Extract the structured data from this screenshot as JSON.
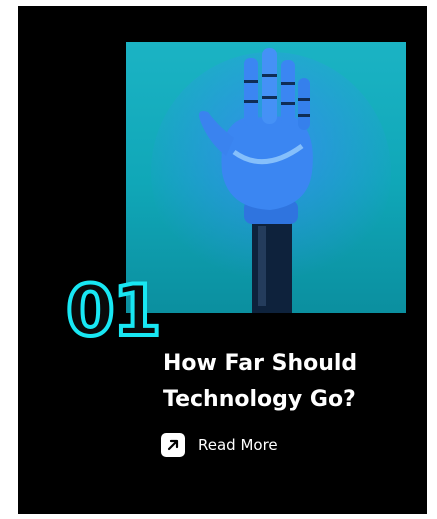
{
  "card": {
    "number": "01",
    "title_line1": "How Far Should",
    "title_line2": "Technology Go?",
    "read_more_label": "Read More",
    "image_name": "robotic-hand-photo",
    "icon": "arrow-up-right-icon",
    "colors": {
      "background": "#000000",
      "accent": "#18e7f3",
      "image_bg": "#10a7b8"
    }
  }
}
